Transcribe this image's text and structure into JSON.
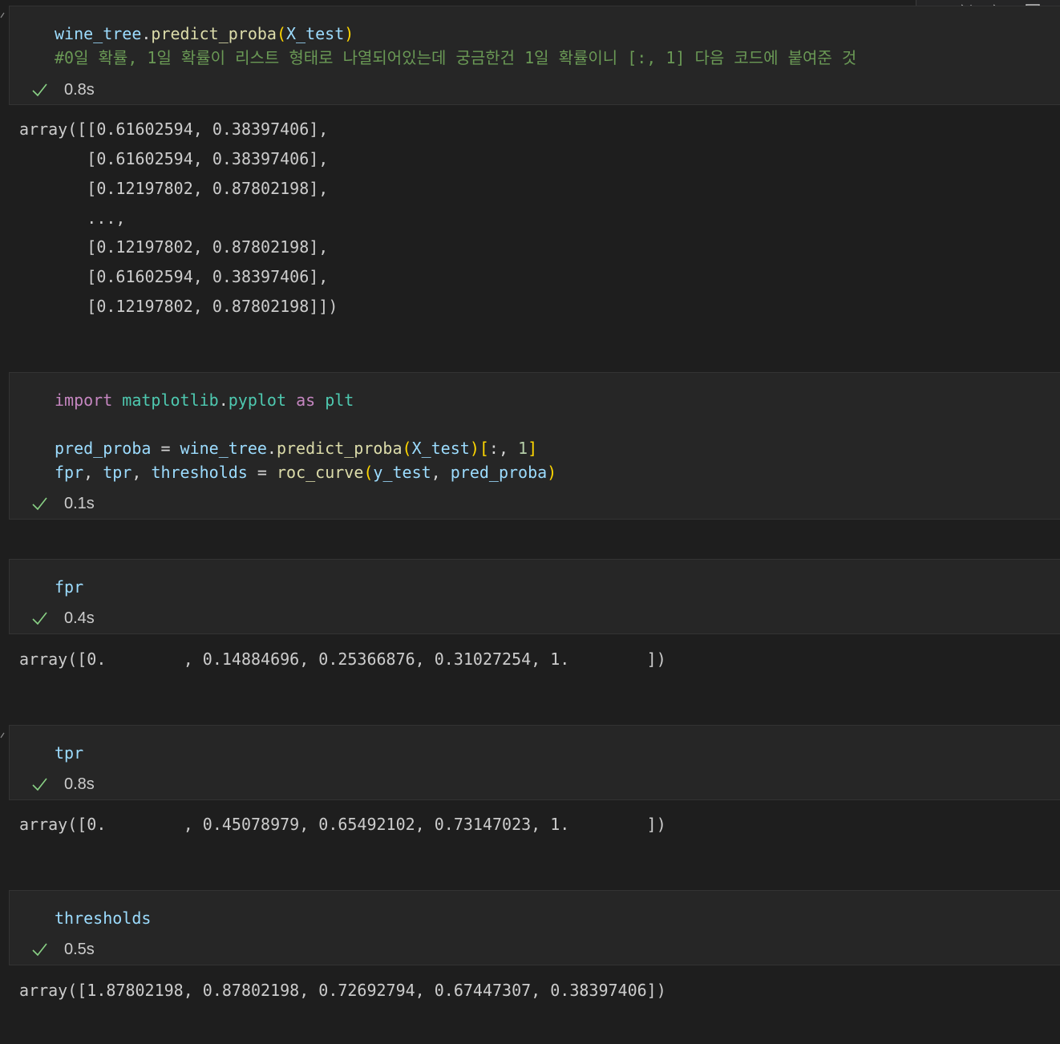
{
  "cells": [
    {
      "code": [
        [
          [
            "wine_tree",
            "var"
          ],
          [
            ".",
            "op"
          ],
          [
            "predict_proba",
            "fn"
          ],
          [
            "(",
            "p1"
          ],
          [
            "X_test",
            "var"
          ],
          [
            ")",
            "p1"
          ]
        ],
        [
          [
            "#0일 확률, 1일 확률이 리스트 형태로 나열되어있는데 궁금한건 1일 확률이니 [:, 1] 다음 코드에 붙여준 것",
            "cmt"
          ]
        ]
      ],
      "status_time": "0.8s",
      "output": [
        "array([[0.61602594, 0.38397406],",
        "       [0.61602594, 0.38397406],",
        "       [0.12197802, 0.87802198],",
        "       ...,",
        "       [0.12197802, 0.87802198],",
        "       [0.61602594, 0.38397406],",
        "       [0.12197802, 0.87802198]])"
      ]
    },
    {
      "code": [
        [
          [
            "import",
            "kw"
          ],
          [
            " ",
            "op"
          ],
          [
            "matplotlib",
            "mod"
          ],
          [
            ".",
            "op"
          ],
          [
            "pyplot",
            "mod"
          ],
          [
            " ",
            "op"
          ],
          [
            "as",
            "kw"
          ],
          [
            " ",
            "op"
          ],
          [
            "plt",
            "mod"
          ]
        ],
        [],
        [
          [
            "pred_proba",
            "var"
          ],
          [
            " = ",
            "op"
          ],
          [
            "wine_tree",
            "var"
          ],
          [
            ".",
            "op"
          ],
          [
            "predict_proba",
            "fn"
          ],
          [
            "(",
            "p1"
          ],
          [
            "X_test",
            "var"
          ],
          [
            ")",
            "p1"
          ],
          [
            "[",
            "p1"
          ],
          [
            ":, ",
            "op"
          ],
          [
            "1",
            "num"
          ],
          [
            "]",
            "p1"
          ]
        ],
        [
          [
            "fpr",
            "var"
          ],
          [
            ", ",
            "op"
          ],
          [
            "tpr",
            "var"
          ],
          [
            ", ",
            "op"
          ],
          [
            "thresholds",
            "var"
          ],
          [
            " = ",
            "op"
          ],
          [
            "roc_curve",
            "fn"
          ],
          [
            "(",
            "p1"
          ],
          [
            "y_test",
            "var"
          ],
          [
            ", ",
            "op"
          ],
          [
            "pred_proba",
            "var"
          ],
          [
            ")",
            "p1"
          ]
        ]
      ],
      "status_time": "0.1s",
      "output": []
    },
    {
      "code": [
        [
          [
            "fpr",
            "var"
          ]
        ]
      ],
      "status_time": "0.4s",
      "output": [
        "array([0.        , 0.14884696, 0.25366876, 0.31027254, 1.        ])"
      ]
    },
    {
      "code": [
        [
          [
            "tpr",
            "var"
          ]
        ]
      ],
      "status_time": "0.8s",
      "output": [
        "array([0.        , 0.45078979, 0.65492102, 0.73147023, 1.        ])"
      ]
    },
    {
      "code": [
        [
          [
            "thresholds",
            "var"
          ]
        ]
      ],
      "status_time": "0.5s",
      "output": [
        "array([1.87802198, 0.87802198, 0.72692794, 0.67447307, 0.38397406])"
      ]
    }
  ],
  "colors": {
    "background": "#1e1e1e",
    "cell_bg": "#262626",
    "check": "#89d185"
  }
}
